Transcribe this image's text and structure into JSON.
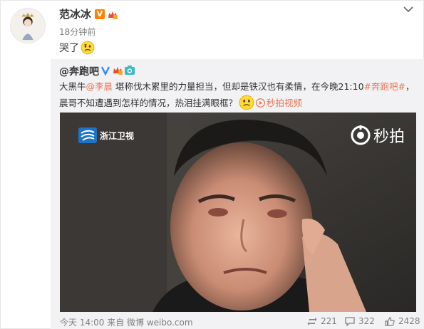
{
  "post": {
    "author": "范冰冰",
    "time": "18分钟前",
    "text": "哭了",
    "emoji": "sad-face-emoji"
  },
  "repost": {
    "author": "@奔跑吧",
    "text_a": "大黑牛",
    "mention": "@李晨",
    "text_b": " 堪称伐木累里的力量担当，但却是铁汉也有柔情，在今晚21:10",
    "hashtag": "#奔跑吧#",
    "text_c": "，晨哥不知遭遇到怎样的情况，热泪挂满眼框？",
    "video_link": "秒拍视频",
    "video": {
      "channel_logo_text": "浙江卫视",
      "watermark_text": "秒拍"
    },
    "footer": {
      "source": "今天 14:00 来自 微博 weibo.com",
      "reposts": "221",
      "comments": "322",
      "likes": "2428"
    }
  },
  "colors": {
    "link": "#eb7350",
    "verified_orange": "#ff8200",
    "repost_bg": "#f2f2f5"
  }
}
